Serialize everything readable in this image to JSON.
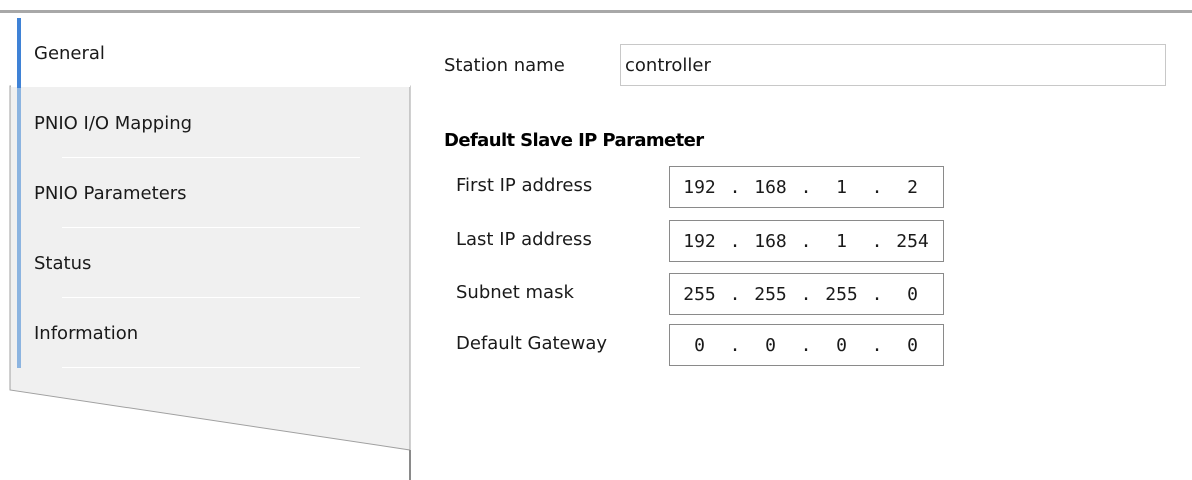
{
  "sidebar": {
    "items": [
      {
        "label": "General",
        "active": true
      },
      {
        "label": "PNIO I/O Mapping",
        "active": false
      },
      {
        "label": "PNIO Parameters",
        "active": false
      },
      {
        "label": "Status",
        "active": false
      },
      {
        "label": "Information",
        "active": false
      }
    ]
  },
  "general": {
    "station_name_label": "Station name",
    "station_name_value": "controller",
    "section_title": "Default Slave IP Parameter",
    "fields": [
      {
        "label": "First IP address",
        "octets": [
          "192",
          "168",
          "1",
          "2"
        ]
      },
      {
        "label": "Last IP address",
        "octets": [
          "192",
          "168",
          "1",
          "254"
        ]
      },
      {
        "label": "Subnet mask",
        "octets": [
          "255",
          "255",
          "255",
          "0"
        ]
      },
      {
        "label": "Default Gateway",
        "octets": [
          "0",
          "0",
          "0",
          "0"
        ]
      }
    ]
  },
  "colors": {
    "accent_active": "#3f82d6",
    "accent_inactive": "#8cb4e0",
    "sidebar_bg": "#f0f0f0"
  }
}
